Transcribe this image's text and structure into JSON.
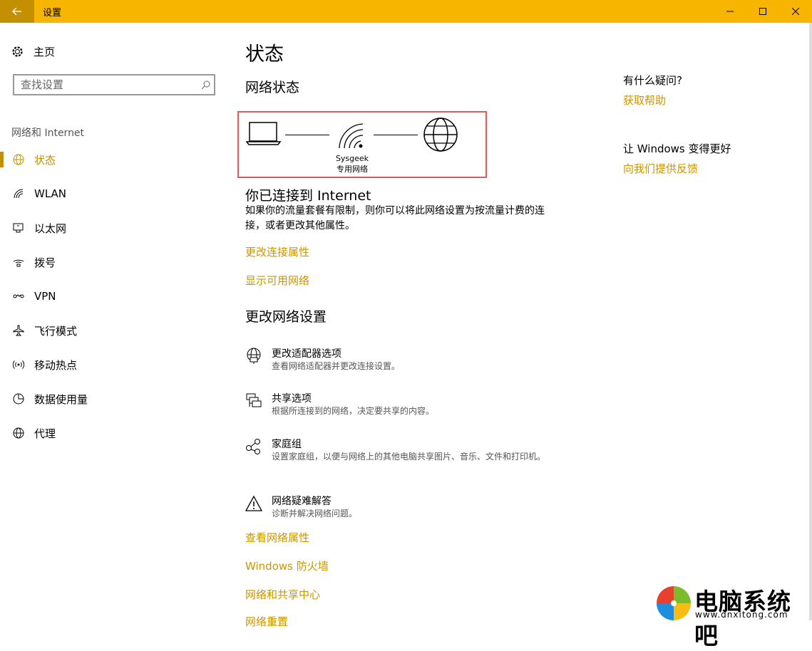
{
  "window": {
    "title": "设置"
  },
  "sidebar": {
    "home_label": "主页",
    "search_placeholder": "查找设置",
    "section_label": "网络和 Internet",
    "items": [
      {
        "label": "状态",
        "icon": "globe-status-icon",
        "active": true
      },
      {
        "label": "WLAN",
        "icon": "wifi-icon"
      },
      {
        "label": "以太网",
        "icon": "ethernet-icon"
      },
      {
        "label": "拨号",
        "icon": "dialup-icon"
      },
      {
        "label": "VPN",
        "icon": "vpn-icon"
      },
      {
        "label": "飞行模式",
        "icon": "airplane-icon"
      },
      {
        "label": "移动热点",
        "icon": "hotspot-icon"
      },
      {
        "label": "数据使用量",
        "icon": "data-usage-icon"
      },
      {
        "label": "代理",
        "icon": "proxy-globe-icon"
      }
    ]
  },
  "main": {
    "title": "状态",
    "network_status_heading": "网络状态",
    "network_name": "Sysgeek",
    "network_type": "专用网络",
    "connected_heading": "你已连接到 Internet",
    "connected_desc": "如果你的流量套餐有限制，则你可以将此网络设置为按流量计费的连接，或者更改其他属性。",
    "links_top": [
      "更改连接属性",
      "显示可用网络"
    ],
    "change_heading": "更改网络设置",
    "options": [
      {
        "title": "更改适配器选项",
        "desc": "查看网络适配器并更改连接设置。",
        "icon": "adapter-icon"
      },
      {
        "title": "共享选项",
        "desc": "根据所连接到的网络，决定要共享的内容。",
        "icon": "sharing-icon"
      },
      {
        "title": "家庭组",
        "desc": "设置家庭组，以便与网络上的其他电脑共享图片、音乐、文件和打印机。",
        "icon": "homegroup-icon"
      },
      {
        "title": "网络疑难解答",
        "desc": "诊断并解决网络问题。",
        "icon": "warning-icon"
      }
    ],
    "links_bottom": [
      "查看网络属性",
      "Windows 防火墙",
      "网络和共享中心",
      "网络重置"
    ]
  },
  "right": {
    "question_title": "有什么疑问?",
    "help_link": "获取帮助",
    "improve_title": "让 Windows 变得更好",
    "feedback_link": "向我们提供反馈"
  },
  "watermark": {
    "text": "电脑系统吧",
    "url": "www.dnxitong.com"
  },
  "colors": {
    "accent": "#f7b500",
    "link": "#c99500",
    "highlight_box": "#e05a5a"
  }
}
